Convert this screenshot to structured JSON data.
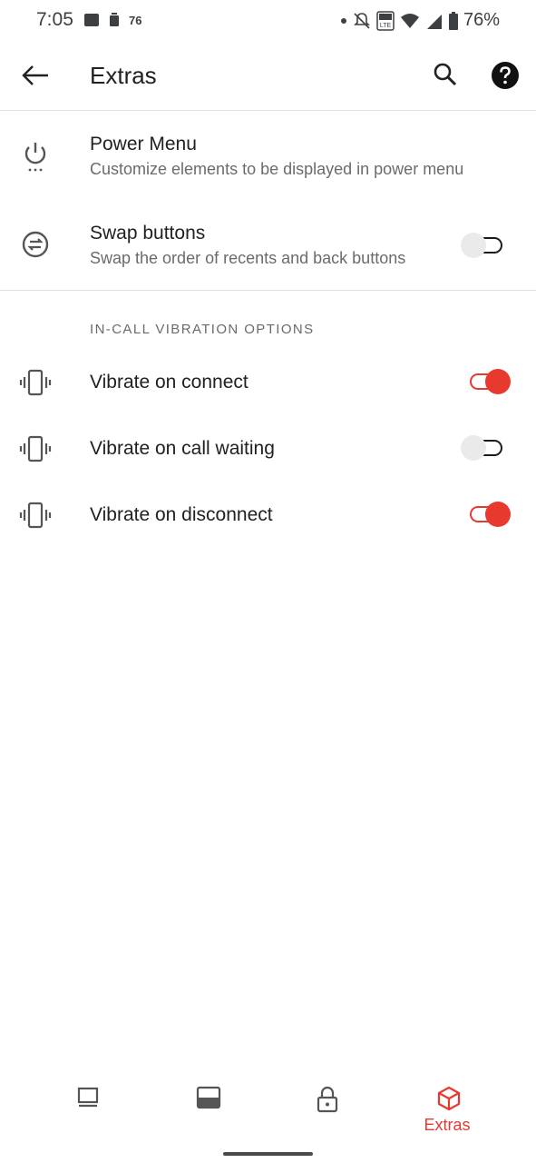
{
  "status_bar": {
    "time": "7:05",
    "small_count": "76",
    "battery_percent": "76%",
    "volte_label": "Vo LTE"
  },
  "app_bar": {
    "title": "Extras"
  },
  "settings": {
    "power_menu": {
      "title": "Power Menu",
      "subtitle": "Customize elements to be displayed in power menu"
    },
    "swap_buttons": {
      "title": "Swap buttons",
      "subtitle": "Swap the order of recents and back buttons",
      "enabled": false
    },
    "section_header": "IN-CALL VIBRATION OPTIONS",
    "vibrate_connect": {
      "title": "Vibrate on connect",
      "enabled": true
    },
    "vibrate_call_waiting": {
      "title": "Vibrate on call waiting",
      "enabled": false
    },
    "vibrate_disconnect": {
      "title": "Vibrate on disconnect",
      "enabled": true
    }
  },
  "bottom_nav": {
    "items": [
      {
        "icon": "customization-icon",
        "label": ""
      },
      {
        "icon": "display-icon",
        "label": ""
      },
      {
        "icon": "lock-icon",
        "label": ""
      },
      {
        "icon": "extras-cube-icon",
        "label": "Extras",
        "active": true
      }
    ]
  },
  "colors": {
    "accent": "#e8392f",
    "text_primary": "#202124",
    "text_secondary": "#6b6b6b"
  }
}
